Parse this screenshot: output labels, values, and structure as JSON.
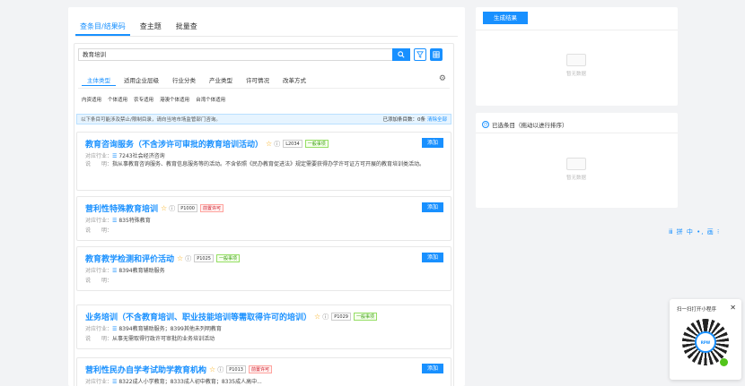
{
  "tabs": [
    "查条目/结果码",
    "查主题",
    "批量查"
  ],
  "search": {
    "value": "教育培训"
  },
  "filter_tabs": [
    "主体类型",
    "适用企业层级",
    "行业分类",
    "产业类型",
    "许可情况",
    "改革方式"
  ],
  "entity_options": [
    "内资适用",
    "个体适用",
    "农专适用",
    "港澳个体适用",
    "台湾个体适用"
  ],
  "tip": {
    "text": "以下条目可能涉及禁止/限制目录，请向当地市场监管部门咨询。",
    "added_label": "已添加条目数：",
    "added_count": "0条",
    "clear": "清除全部"
  },
  "labels": {
    "industry": "对应行业：",
    "desc_label": "说　　明：",
    "add": "添加"
  },
  "items": [
    {
      "title": "教育咨询服务（不含涉许可审批的教育培训活动）",
      "code": "L2034",
      "badge": "一般事项",
      "industry": "7243社会经济咨询",
      "desc": "指从事教育咨询服务、教育信息服务等的活动。不含依照《民办教育促进法》规定需要获得办学许可证方可开展的教育培训类活动。"
    },
    {
      "title": "营利性特殊教育培训",
      "code": "P1000",
      "badge": "前置许可",
      "industry": "835特殊教育",
      "desc": ""
    },
    {
      "title": "教育教学检测和评价活动",
      "code": "P1025",
      "badge": "一般事项",
      "industry": "8394教育辅助服务",
      "desc": ""
    },
    {
      "title": "业务培训（不含教育培训、职业技能培训等需取得许可的培训）",
      "code": "P1029",
      "badge": "一般事项",
      "industry": "8394教育辅助服务；8399其他未列明教育",
      "desc": "从事无需取得行政许可审批的业务培训活动"
    },
    {
      "title": "营利性民办自学考试助学教育机构",
      "code": "P1013",
      "badge": "前置许可",
      "industry": "8322成人小学教育；8333成人初中教育；8335成人高中...",
      "desc": ""
    }
  ],
  "right": {
    "generate": "生成结果",
    "empty": "暂无数据",
    "selected_title": "已选条目（拖动以进行排序）"
  },
  "toolbar_text": "ⅲ 拼 中 •, 画 ⁝",
  "mini_program": {
    "title": "扫一扫打开小程序",
    "close": "✕",
    "logo": "RPW"
  },
  "colors": {
    "primary": "#1890ff",
    "star": "#faad14"
  }
}
